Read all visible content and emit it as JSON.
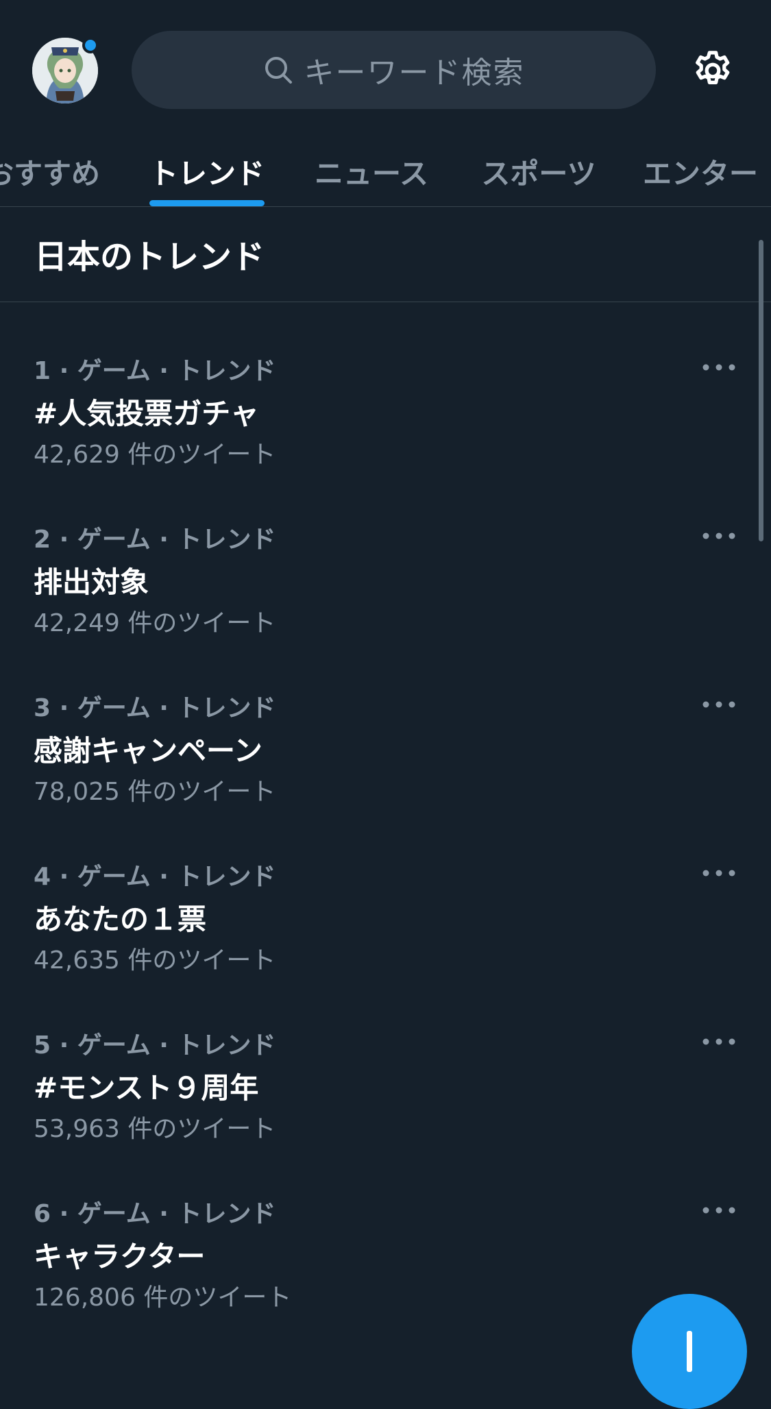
{
  "header": {
    "search_placeholder": "キーワード検索",
    "avatar_icon": "user-avatar",
    "search_icon": "search-icon",
    "settings_icon": "gear-icon"
  },
  "tabs": [
    {
      "label": "おすすめ",
      "active": false
    },
    {
      "label": "トレンド",
      "active": true
    },
    {
      "label": "ニュース",
      "active": false
    },
    {
      "label": "スポーツ",
      "active": false
    },
    {
      "label": "エンター",
      "active": false
    }
  ],
  "section": {
    "title": "日本のトレンド"
  },
  "trends": [
    {
      "meta": "1 · ゲーム · トレンド",
      "name": "#人気投票ガチャ",
      "count": "42,629 件のツイート"
    },
    {
      "meta": "2 · ゲーム · トレンド",
      "name": "排出対象",
      "count": "42,249 件のツイート"
    },
    {
      "meta": "3 · ゲーム · トレンド",
      "name": "感謝キャンペーン",
      "count": "78,025 件のツイート"
    },
    {
      "meta": "4 · ゲーム · トレンド",
      "name": "あなたの１票",
      "count": "42,635 件のツイート"
    },
    {
      "meta": "5 · ゲーム · トレンド",
      "name": "#モンスト９周年",
      "count": "53,963 件のツイート"
    },
    {
      "meta": "6 · ゲーム · トレンド",
      "name": "キャラクター",
      "count": "126,806 件のツイート"
    }
  ],
  "colors": {
    "background": "#15202b",
    "accent": "#1d9bf0",
    "secondary_text": "#8b98a5",
    "divider": "#38444d"
  }
}
